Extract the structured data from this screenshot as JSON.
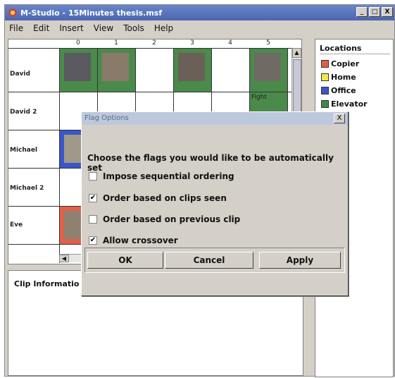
{
  "window": {
    "title": "M-Studio - 15Minutes thesis.msf",
    "min": "_",
    "max": "□",
    "close": "X"
  },
  "menu": [
    "File",
    "Edit",
    "Insert",
    "View",
    "Tools",
    "Help"
  ],
  "grid": {
    "columns": [
      "0",
      "1",
      "2",
      "3",
      "4",
      "5"
    ],
    "rows": [
      "David",
      "David 2",
      "Michael",
      "Michael 2",
      "Eve"
    ],
    "cell_caption": "Fight"
  },
  "locations": {
    "title": "Locations",
    "items": [
      {
        "label": "Copier",
        "color": "#e0604a"
      },
      {
        "label": "Home",
        "color": "#f2e84a"
      },
      {
        "label": "Office",
        "color": "#3a56c8"
      },
      {
        "label": "Elevator",
        "color": "#3a8a4a"
      }
    ]
  },
  "clip_info": {
    "label": "Clip Informatio"
  },
  "dialog": {
    "title": "Flag Options",
    "close": "X",
    "prompt": "Choose the flags you would like to be automatically set",
    "options": [
      {
        "label": "Impose sequential ordering",
        "checked": false,
        "mark": ""
      },
      {
        "label": "Order based on clips seen",
        "checked": true,
        "mark": "✔"
      },
      {
        "label": "Order based on previous clip",
        "checked": false,
        "mark": ""
      },
      {
        "label": "Allow crossover",
        "checked": true,
        "mark": "✔"
      }
    ],
    "buttons": {
      "ok": "OK",
      "cancel": "Cancel",
      "apply": "Apply"
    }
  }
}
